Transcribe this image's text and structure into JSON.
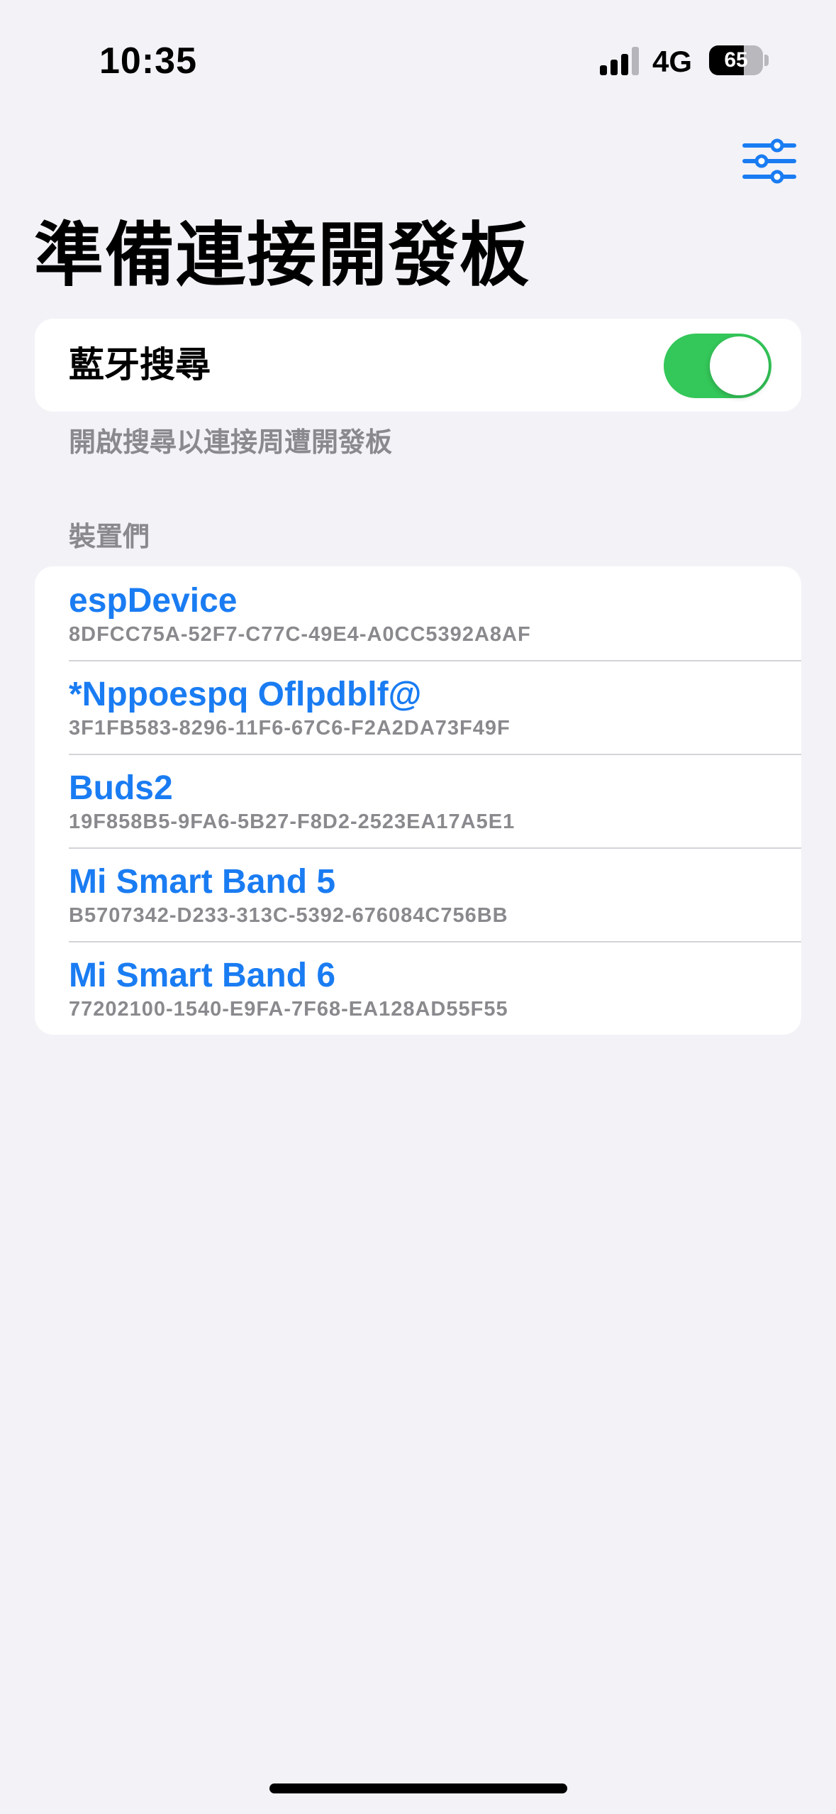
{
  "status_bar": {
    "time": "10:35",
    "network": "4G",
    "battery": "65",
    "battery_level": 0.65
  },
  "header": {
    "filter_icon": "sliders-icon",
    "title": "準備連接開發板"
  },
  "bluetooth": {
    "label": "藍牙搜尋",
    "enabled": true,
    "footer": "開啟搜尋以連接周遭開發板"
  },
  "devices": {
    "header": "裝置們",
    "items": [
      {
        "name": "espDevice",
        "uuid": "8DFCC75A-52F7-C77C-49E4-A0CC5392A8AF"
      },
      {
        "name": "*Nppoespq Oflpdblf@",
        "uuid": "3F1FB583-8296-11F6-67C6-F2A2DA73F49F"
      },
      {
        "name": "Buds2",
        "uuid": "19F858B5-9FA6-5B27-F8D2-2523EA17A5E1"
      },
      {
        "name": "Mi Smart Band 5",
        "uuid": "B5707342-D233-313C-5392-676084C756BB"
      },
      {
        "name": "Mi Smart Band 6",
        "uuid": "77202100-1540-E9FA-7F68-EA128AD55F55"
      }
    ]
  },
  "colors": {
    "accent": "#1a7cf2",
    "toggle_on": "#34c759",
    "background": "#f2f2f7",
    "secondary_text": "#8a8a8e"
  }
}
